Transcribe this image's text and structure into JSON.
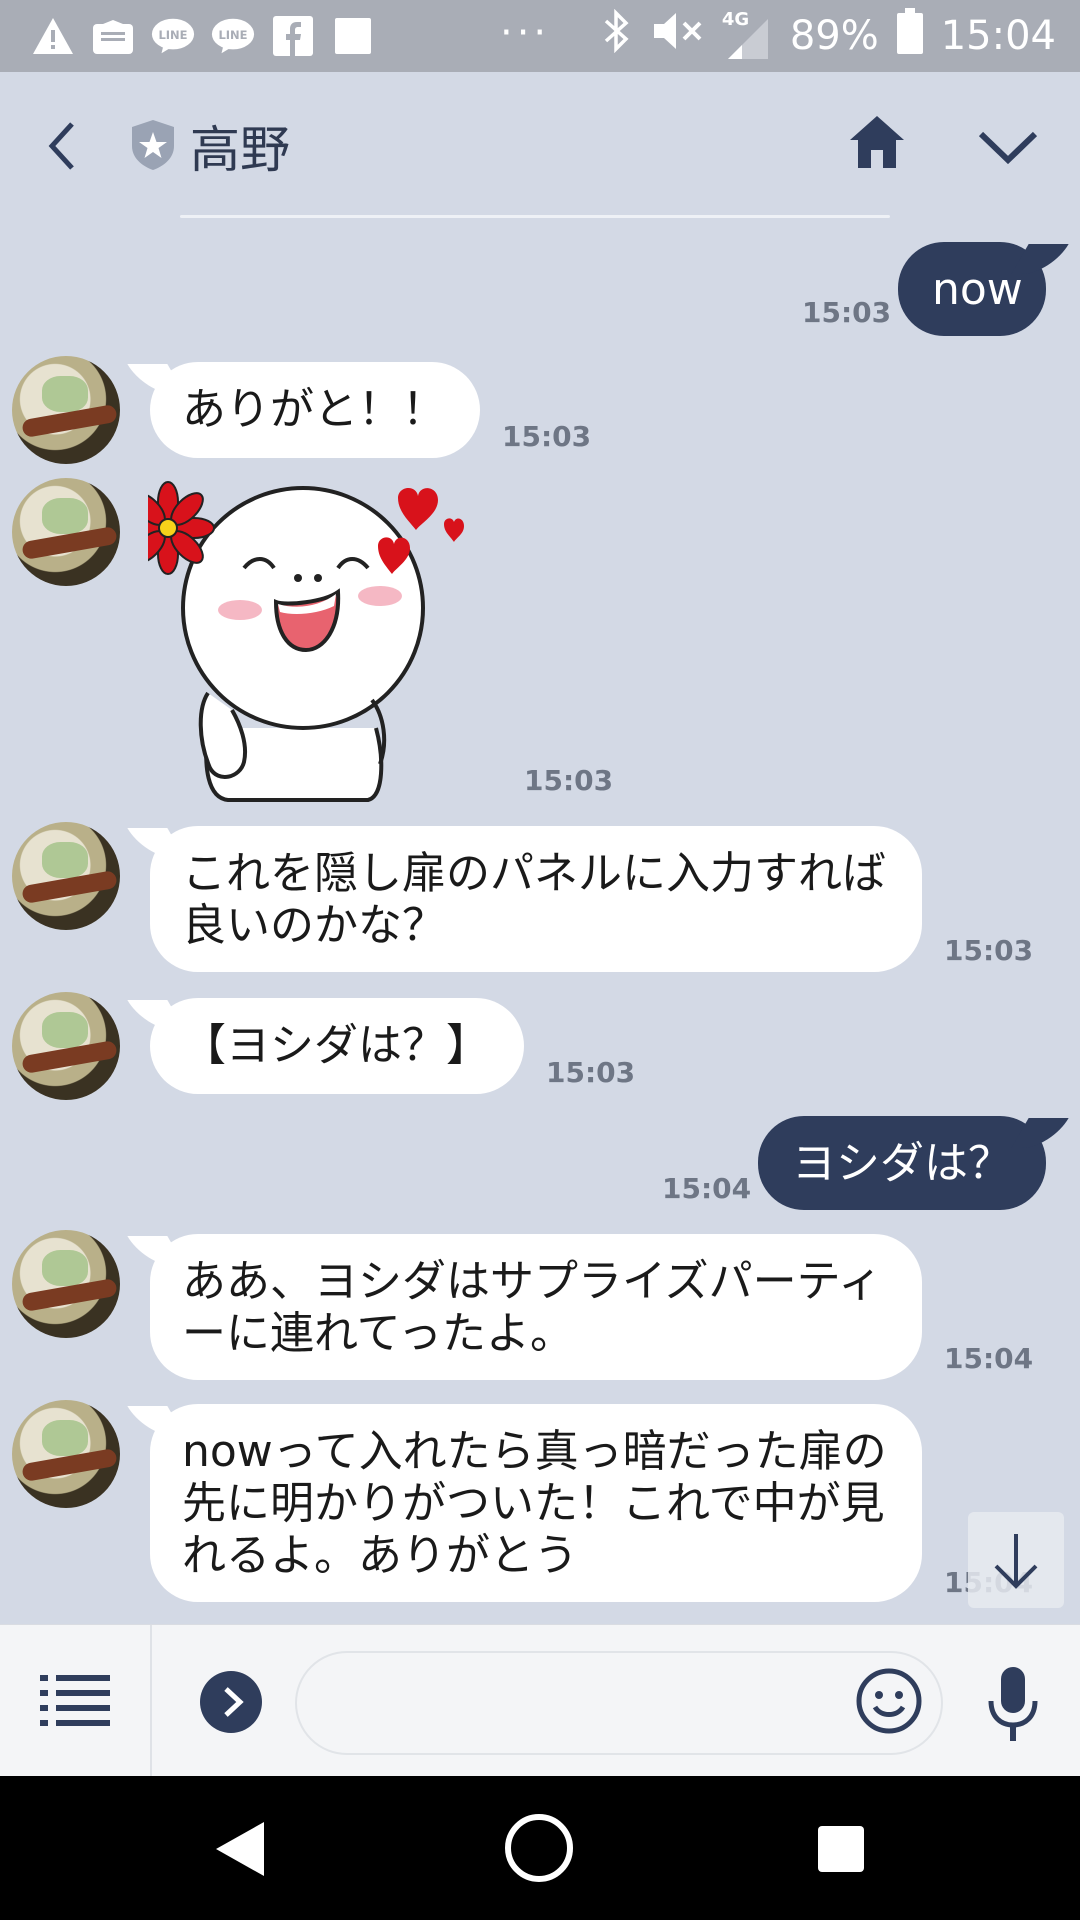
{
  "status_bar": {
    "dots": "···",
    "network": "4G",
    "battery": "89%",
    "time": "15:04",
    "icons": [
      "warning-icon",
      "mail-icon",
      "line-icon",
      "line-icon",
      "facebook-icon",
      "square-icon",
      "bluetooth-icon",
      "mute-icon",
      "signal-icon",
      "battery-icon"
    ]
  },
  "header": {
    "title": "高野",
    "icons": [
      "back-chevron-icon",
      "shield-star-icon",
      "home-icon",
      "chevron-down-icon"
    ]
  },
  "messages": [
    {
      "side": "out",
      "text": "now",
      "time": "15:03"
    },
    {
      "side": "in",
      "text": "ありがと！！",
      "time": "15:03"
    },
    {
      "side": "in",
      "type": "sticker",
      "time": "15:03"
    },
    {
      "side": "in",
      "text": "これを隠し扉のパネルに入力すれば良いのかな？",
      "time": "15:03"
    },
    {
      "side": "in",
      "text": "【ヨシダは？】",
      "time": "15:03"
    },
    {
      "side": "out",
      "text": "ヨシダは？",
      "time": "15:04"
    },
    {
      "side": "in",
      "text": "ああ、ヨシダはサプライズパーティーに連れてったよ。",
      "time": "15:04"
    },
    {
      "side": "in",
      "text": "nowって入れたら真っ暗だった扉の先に明かりがついた！これで中が見れるよ。ありがとう",
      "time": "15:04"
    }
  ],
  "colors": {
    "outgoing": "#2f3d5c",
    "incoming": "#ffffff",
    "background": "#d3d9e5"
  }
}
